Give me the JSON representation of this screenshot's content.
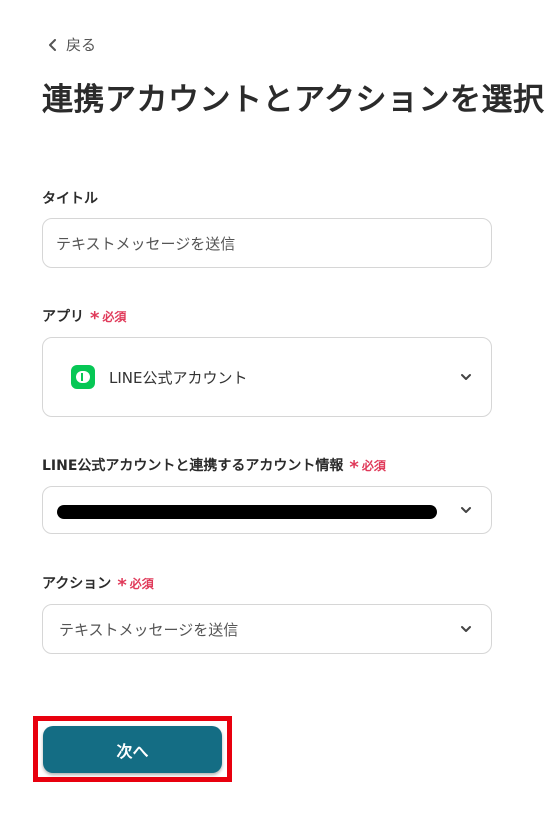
{
  "nav": {
    "back_label": "戻る"
  },
  "page": {
    "title": "連携アカウントとアクションを選択"
  },
  "form": {
    "title_field": {
      "label": "タイトル",
      "value": "テキストメッセージを送信"
    },
    "app_field": {
      "label": "アプリ",
      "required": "必須",
      "value": "LINE公式アカウント",
      "icon": "line-logo-icon"
    },
    "account_field": {
      "label": "LINE公式アカウントと連携するアカウント情報",
      "required": "必須",
      "value_redacted": true
    },
    "action_field": {
      "label": "アクション",
      "required": "必須",
      "value": "テキストメッセージを送信"
    }
  },
  "actions": {
    "next_label": "次へ"
  },
  "colors": {
    "accent": "#146d84",
    "required": "#e03a5a",
    "highlight": "#e8000e",
    "line_green": "#06c755"
  }
}
